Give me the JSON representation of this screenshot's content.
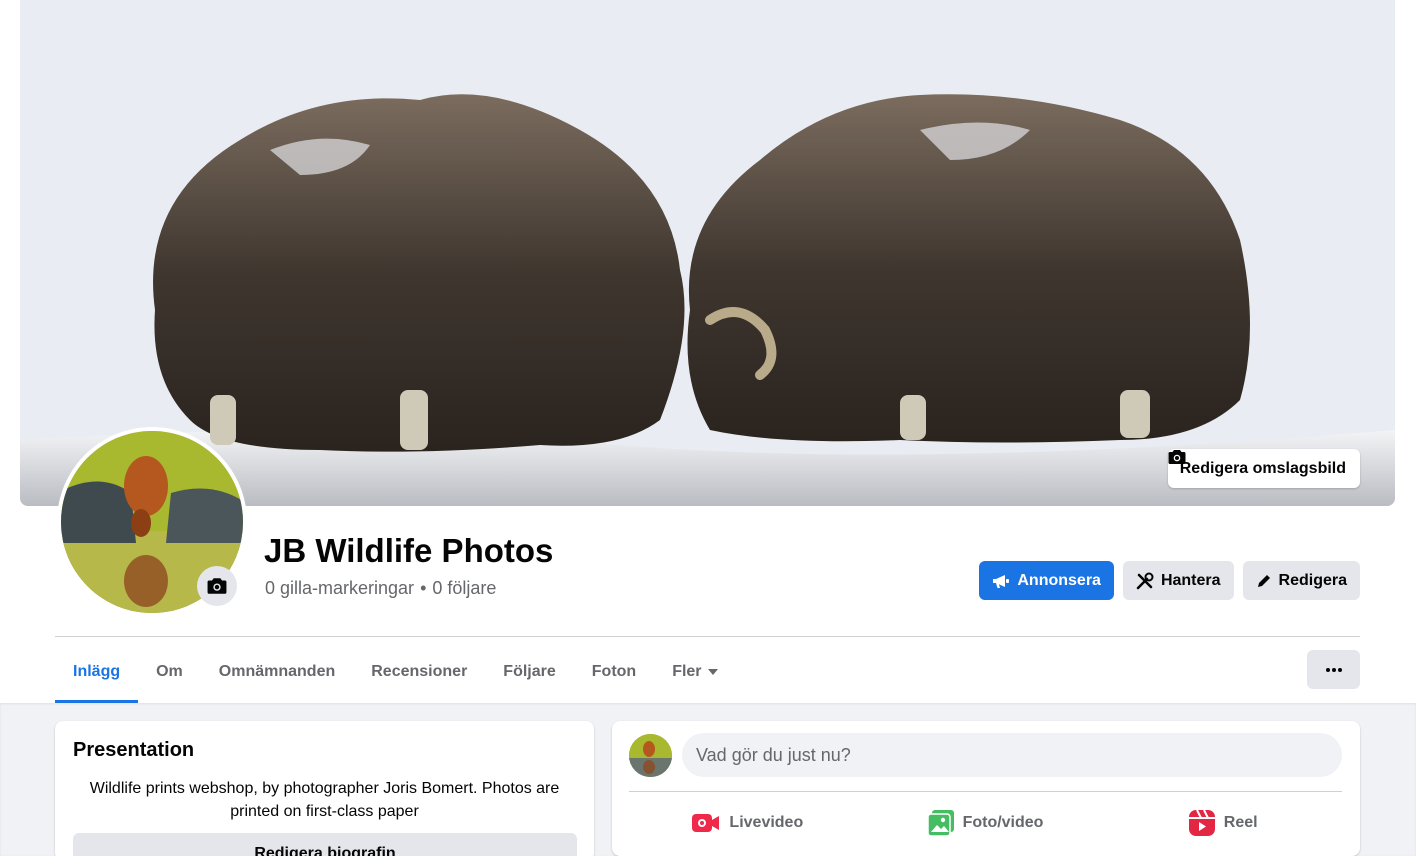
{
  "cover": {
    "edit_label": "Redigera omslagsbild",
    "edit_icon": "camera-icon"
  },
  "page": {
    "title": "JB Wildlife Photos",
    "likes": "0 gilla-markeringar",
    "separator": "•",
    "followers": "0 följare"
  },
  "actions": {
    "advertise": "Annonsera",
    "manage": "Hantera",
    "edit": "Redigera"
  },
  "tabs": [
    {
      "label": "Inlägg",
      "active": true
    },
    {
      "label": "Om"
    },
    {
      "label": "Omnämnanden"
    },
    {
      "label": "Recensioner"
    },
    {
      "label": "Följare"
    },
    {
      "label": "Foton"
    },
    {
      "label": "Fler"
    }
  ],
  "more_button": "···",
  "intro": {
    "title": "Presentation",
    "bio": "Wildlife prints webshop, by photographer Joris Bomert. Photos are printed on first-class paper",
    "edit_bio": "Redigera biografin"
  },
  "composer": {
    "placeholder": "Vad gör du just nu?",
    "live": "Livevideo",
    "photo": "Foto/video",
    "reel": "Reel"
  },
  "colors": {
    "primary": "#1b74e4",
    "secondary_bg": "#e4e6eb",
    "muted_text": "#65676b",
    "live_red": "#f02849",
    "photo_green": "#45bd62",
    "reel_red": "#e42645"
  }
}
